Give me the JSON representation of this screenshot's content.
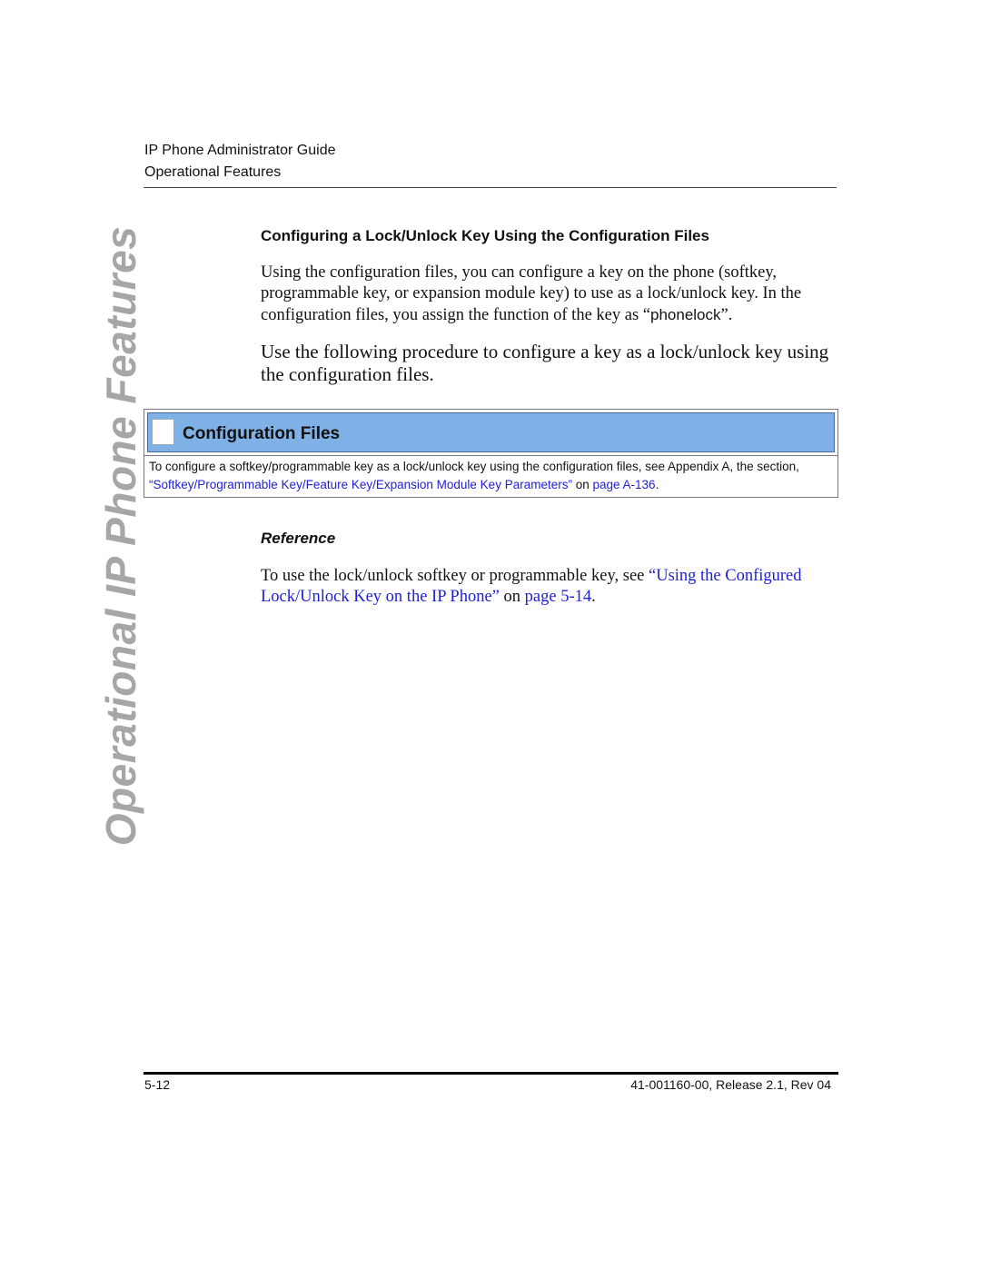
{
  "header": {
    "guide_title": "IP Phone Administrator Guide",
    "chapter": "Operational Features"
  },
  "side_title": "Operational IP Phone Features",
  "section": {
    "heading": "Configuring a Lock/Unlock Key Using the Configuration Files",
    "para1_before": "Using the configuration files, you can configure a key on the phone (softkey, programmable key, or expansion module key) to use as a lock/unlock key. In the configuration files, you assign the function of the key as “",
    "para1_code": "phonelock",
    "para1_after": "”.",
    "para2": "Use the following procedure to configure a key as a lock/unlock key using the configuration files."
  },
  "config_box": {
    "title": "Configuration Files",
    "text_before": "To configure a softkey/programmable key as a lock/unlock key using the configuration files, see Appendix A, the section, ",
    "link_section": "“Softkey/Programmable Key/Feature Key/Expansion Module Key Parameters”",
    "text_on": " on ",
    "link_page": "page A-136",
    "text_end": "."
  },
  "reference": {
    "heading": "Reference",
    "text_before": "To use the lock/unlock softkey or programmable key, see ",
    "link_section": "“Using the Configured Lock/Unlock Key on the IP Phone”",
    "text_on": " on ",
    "link_page": "page 5-14",
    "text_end": "."
  },
  "footer": {
    "page_number": "5-12",
    "doc_id": "41-001160-00, Release 2.1, Rev 04"
  },
  "colors": {
    "box_blue": "#7fb0e6",
    "link_blue": "#1f1fd6",
    "side_title_gray": "#a6a6a6"
  }
}
